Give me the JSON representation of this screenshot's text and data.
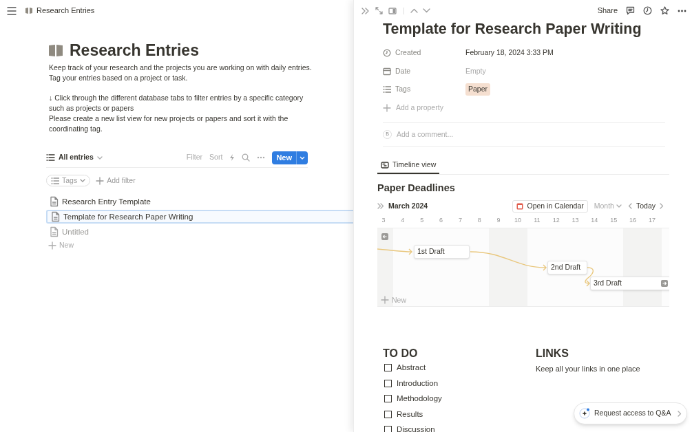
{
  "left_pane": {
    "breadcrumb": "Research Entries",
    "title": "Research Entries",
    "description": [
      "Keep track of your research and the projects you are working on with daily entries.",
      "Tag your entries based on a project or task."
    ],
    "instructions": [
      "↓ Click through the different database tabs to filter entries by a specific category such as projects or papers",
      "Please create a new list view for new projects or papers and sort it with the coordinating tag."
    ],
    "view": {
      "label": "All entries",
      "actions": [
        "Filter",
        "Sort"
      ],
      "new_button": "New"
    },
    "filters": {
      "tag_filter": "Tags",
      "add_filter": "Add filter"
    },
    "entries": [
      {
        "title": "Research Entry Template",
        "selected": false,
        "placeholder": false
      },
      {
        "title": "Template for Research Paper Writing",
        "selected": true,
        "placeholder": false
      },
      {
        "title": "Untitled",
        "selected": false,
        "placeholder": true
      }
    ],
    "new_entry": "New"
  },
  "right_pane": {
    "toolbar": {
      "share": "Share"
    },
    "title": "Template for Research Paper Writing",
    "properties": [
      {
        "kind": "clock",
        "name": "Created",
        "value": "February 18, 2024 3:33 PM",
        "empty": false
      },
      {
        "kind": "calendar",
        "name": "Date",
        "value": "Empty",
        "empty": true
      },
      {
        "kind": "list",
        "name": "Tags",
        "tag": "Paper"
      }
    ],
    "add_property": "Add a property",
    "comment": {
      "avatar": "B",
      "placeholder": "Add a comment..."
    },
    "tab": {
      "label": "Timeline view",
      "selected": true
    },
    "timeline": {
      "title": "Paper Deadlines",
      "month": "March 2024",
      "open_calendar": "Open in Calendar",
      "scale": "Month",
      "today": "Today",
      "days": [
        "3",
        "4",
        "5",
        "6",
        "7",
        "8",
        "9",
        "10",
        "11",
        "12",
        "13",
        "14",
        "15",
        "16",
        "17"
      ],
      "items": [
        "1st Draft",
        "2nd Draft",
        "3rd Draft"
      ],
      "new": "New"
    },
    "todo": {
      "heading": "TO DO",
      "items": [
        {
          "label": "Abstract",
          "checked": false
        },
        {
          "label": "Introduction",
          "checked": false
        },
        {
          "label": "Methodology",
          "checked": false
        },
        {
          "label": "Results",
          "checked": false
        },
        {
          "label": "Discussion",
          "checked": false
        }
      ]
    },
    "links": {
      "heading": "LINKS",
      "text": "Keep all your links in one place"
    },
    "qa_button": "Request access to Q&A"
  }
}
